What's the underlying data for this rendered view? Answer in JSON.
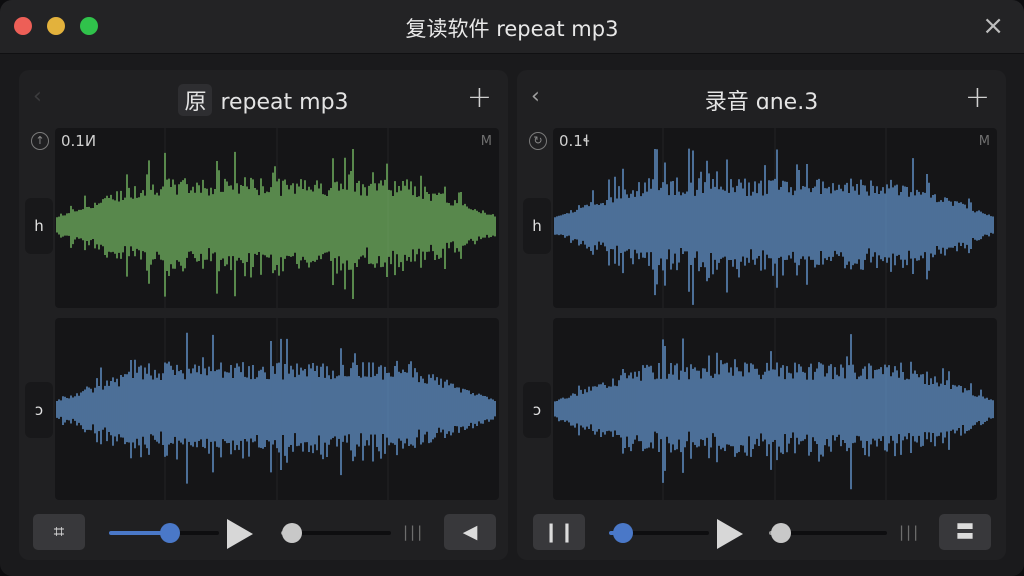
{
  "window": {
    "title": "复读软件 repeat mp3",
    "close_icon": "×"
  },
  "panels": [
    {
      "badge": "原",
      "title": "repeat mp3",
      "back_glyph": "‹",
      "add_glyph": "+",
      "time": "0.1И",
      "marker": "M",
      "channel_top": "h",
      "channel_bottom": "ɔ",
      "top_color": "#6aa55a",
      "bottom_color": "#5a86b8",
      "left_button": "⌗",
      "right_button": "◀",
      "progress": 0.55,
      "volume": 0.1
    },
    {
      "badge": "",
      "title": "录音 ɑne.3",
      "back_glyph": "‹",
      "add_glyph": "+",
      "time": "0.1ɬ",
      "marker": "M",
      "channel_top": "h",
      "channel_bottom": "ɔ",
      "top_color": "#5a86b8",
      "bottom_color": "#5a86b8",
      "left_button": "❙❙",
      "right_button": "〓",
      "progress": 0.14,
      "volume": 0.1
    }
  ],
  "colors": {
    "accent": "#4a78c8",
    "traffic_red": "#ed5f57",
    "traffic_yellow": "#e3b23c",
    "traffic_green": "#30c24b"
  }
}
